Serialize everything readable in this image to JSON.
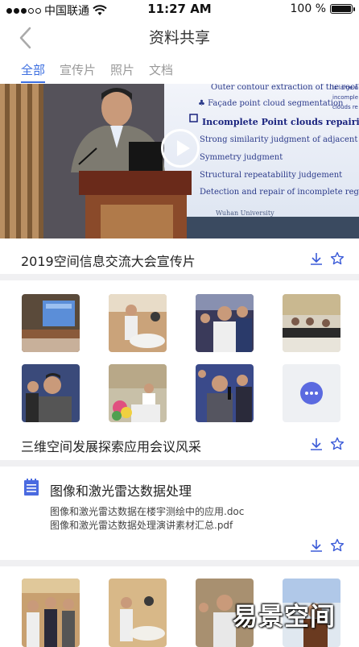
{
  "status_bar": {
    "carrier": "中国联通",
    "time": "11:27 AM",
    "battery_text": "100 %",
    "battery_level": 1.0
  },
  "nav": {
    "title": "资料共享",
    "back_icon": "chevron-left-icon"
  },
  "tabs": [
    {
      "label": "全部",
      "active": true
    },
    {
      "label": "宣传片",
      "active": false
    },
    {
      "label": "照片",
      "active": false
    },
    {
      "label": "文档",
      "active": false
    }
  ],
  "video_card": {
    "title": "2019空间信息交流大会宣传片",
    "slide_lines": [
      "Outer contour extraction of the roof",
      "Façade point cloud segmentation",
      "Incomplete Point clouds repairing",
      "Strong similarity judgment of adjacent buildings",
      "Symmetry judgment",
      "Structural repeatability judgement",
      "Detection and repair of incomplete regions",
      "Wuhan University"
    ],
    "slide_right_text": [
      "is large n",
      "incomple",
      "clouds re"
    ]
  },
  "photo_card": {
    "title": "三维空间发展探索应用会议风采",
    "more_icon": "more-dots-icon"
  },
  "doc_card": {
    "title": "图像和激光雷达数据处理",
    "files": [
      "图像和激光雷达数据在楼宇测绘中的应用.doc",
      "图像和激光雷达数据处理演讲素材汇总.pdf"
    ]
  },
  "watermark": "易景空间",
  "colors": {
    "accent": "#3d6fe0",
    "icon_blue": "#3b5bd8",
    "more_purple": "#5b6ae0",
    "separator": "#f0f0f2"
  }
}
